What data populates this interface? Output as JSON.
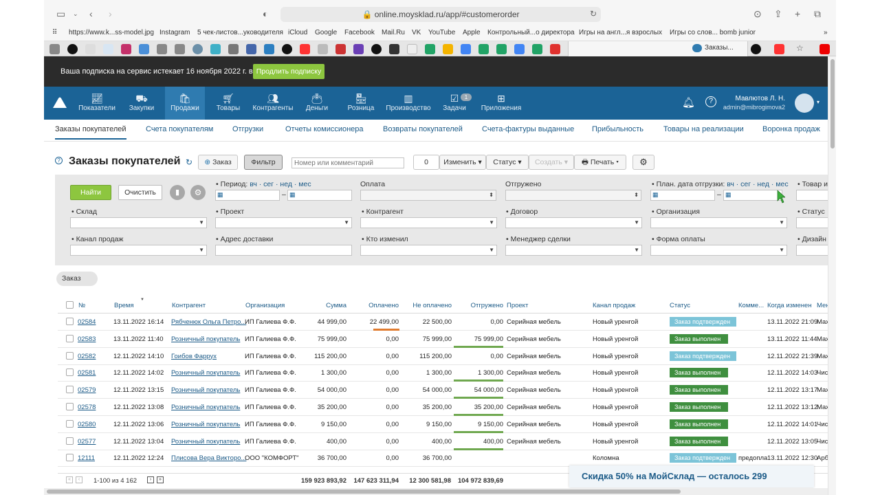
{
  "browser": {
    "url": "online.moysklad.ru/app/#customerorder",
    "bookmarks": [
      "https://www.k...ss-model.jpg",
      "Instagram",
      "5 чек-листов...уководителя",
      "iCloud",
      "Google",
      "Facebook",
      "Mail.Ru",
      "VK",
      "YouTube",
      "Apple",
      "Контрольный...о директора",
      "Игры на англ...я взрослых",
      "Игры со слов... bomb junior"
    ],
    "active_tab": "Заказы..."
  },
  "subscription": {
    "message": "Ваша подписка на сервис истекает 16 ноября 2022 г. в 07:31",
    "button": "Продлить подписку"
  },
  "nav": {
    "items": [
      {
        "label": "Показатели"
      },
      {
        "label": "Закупки"
      },
      {
        "label": "Продажи"
      },
      {
        "label": "Товары"
      },
      {
        "label": "Контрагенты"
      },
      {
        "label": "Деньги"
      },
      {
        "label": "Розница"
      },
      {
        "label": "Производство"
      },
      {
        "label": "Задачи",
        "badge": "1"
      },
      {
        "label": "Приложения"
      }
    ],
    "user_name": "Мавлютов Л. Н.",
    "user_email": "admin@mibrogimova2"
  },
  "subnav": [
    "Заказы покупателей",
    "Счета покупателям",
    "Отгрузки",
    "Отчеты комиссионера",
    "Возвраты покупателей",
    "Счета-фактуры выданные",
    "Прибыльность",
    "Товары на реализации",
    "Воронка продаж"
  ],
  "toolbar": {
    "title": "Заказы покупателей",
    "add_label": "Заказ",
    "filter_label": "Фильтр",
    "search_placeholder": "Номер или комментарий",
    "count": "0",
    "change_label": "Изменить",
    "status_label": "Статус",
    "create_label": "Создать",
    "print_label": "Печать"
  },
  "filter": {
    "find": "Найти",
    "clear": "Очистить",
    "period_label": "Период:",
    "period_links": "вч · сег · нед · мес",
    "payment_label": "Оплата",
    "shipped_label": "Отгружено",
    "plan_label": "План. дата отгрузки:",
    "plan_links": "вч · сег · нед · мес",
    "goods_label": "Товар и",
    "warehouse_label": "Склад",
    "project_label": "Проект",
    "counterparty_label": "Контрагент",
    "contract_label": "Договор",
    "organization_label": "Организация",
    "status_label": "Статус",
    "channel_label": "Канал продаж",
    "address_label": "Адрес доставки",
    "modified_by_label": "Кто изменил",
    "manager_label": "Менеджер сделки",
    "payment_form_label": "Форма оплаты",
    "design_label": "Дизайн"
  },
  "chip": "Заказ",
  "table": {
    "headers": {
      "num": "№",
      "time": "Время",
      "cp": "Контрагент",
      "org": "Организация",
      "sum": "Сумма",
      "paid": "Оплачено",
      "unpaid": "Не оплачено",
      "shipped": "Отгружено",
      "project": "Проект",
      "channel": "Канал продаж",
      "status": "Статус",
      "comment": "Комме...",
      "modified": "Когда изменен",
      "manager": "Мене"
    },
    "rows": [
      {
        "num": "02584",
        "time": "13.11.2022 16:14",
        "cp": "Рябченюк Ольга Петро...",
        "org": "ИП Галиева Ф.Ф.",
        "sum": "44 999,00",
        "paid": "22 499,00",
        "unpaid": "22 500,00",
        "shipped": "0,00",
        "project": "Серийная мебель",
        "channel": "Новый уренгой",
        "status": "Заказ подтвержден",
        "status_color": "#7cc4d8",
        "comment": "",
        "modified": "13.11.2022 21:09",
        "manager": "Мах"
      },
      {
        "num": "02583",
        "time": "13.11.2022 11:40",
        "cp": "Розничный покупатель",
        "org": "ИП Галиева Ф.Ф.",
        "sum": "75 999,00",
        "paid": "0,00",
        "unpaid": "75 999,00",
        "shipped": "75 999,00",
        "project": "Серийная мебель",
        "channel": "Новый уренгой",
        "status": "Заказ выполнен",
        "status_color": "#3f8f3f",
        "comment": "",
        "modified": "13.11.2022 11:44",
        "manager": "Мах"
      },
      {
        "num": "02582",
        "time": "12.11.2022 14:10",
        "cp": "Гоибов Фаррух",
        "org": "ИП Галиева Ф.Ф.",
        "sum": "115 200,00",
        "paid": "0,00",
        "unpaid": "115 200,00",
        "shipped": "0,00",
        "project": "Серийная мебель",
        "channel": "Новый уренгой",
        "status": "Заказ подтвержден",
        "status_color": "#7cc4d8",
        "comment": "",
        "modified": "12.11.2022 21:39",
        "manager": "Мах"
      },
      {
        "num": "02581",
        "time": "12.11.2022 14:02",
        "cp": "Розничный покупатель",
        "org": "ИП Галиева Ф.Ф.",
        "sum": "1 300,00",
        "paid": "0,00",
        "unpaid": "1 300,00",
        "shipped": "1 300,00",
        "project": "Серийная мебель",
        "channel": "Новый уренгой",
        "status": "Заказ выполнен",
        "status_color": "#3f8f3f",
        "comment": "",
        "modified": "12.11.2022 14:03",
        "manager": "Чис"
      },
      {
        "num": "02579",
        "time": "12.11.2022 13:15",
        "cp": "Розничный покупатель",
        "org": "ИП Галиева Ф.Ф.",
        "sum": "54 000,00",
        "paid": "0,00",
        "unpaid": "54 000,00",
        "shipped": "54 000,00",
        "project": "Серийная мебель",
        "channel": "Новый уренгой",
        "status": "Заказ выполнен",
        "status_color": "#3f8f3f",
        "comment": "",
        "modified": "12.11.2022 13:17",
        "manager": "Мах"
      },
      {
        "num": "02578",
        "time": "12.11.2022 13:08",
        "cp": "Розничный покупатель",
        "org": "ИП Галиева Ф.Ф.",
        "sum": "35 200,00",
        "paid": "0,00",
        "unpaid": "35 200,00",
        "shipped": "35 200,00",
        "project": "Серийная мебель",
        "channel": "Новый уренгой",
        "status": "Заказ выполнен",
        "status_color": "#3f8f3f",
        "comment": "",
        "modified": "12.11.2022 13:12",
        "manager": "Мах"
      },
      {
        "num": "02580",
        "time": "12.11.2022 13:06",
        "cp": "Розничный покупатель",
        "org": "ИП Галиева Ф.Ф.",
        "sum": "9 150,00",
        "paid": "0,00",
        "unpaid": "9 150,00",
        "shipped": "9 150,00",
        "project": "Серийная мебель",
        "channel": "Новый уренгой",
        "status": "Заказ выполнен",
        "status_color": "#3f8f3f",
        "comment": "",
        "modified": "12.11.2022 14:01",
        "manager": "Чис"
      },
      {
        "num": "02577",
        "time": "12.11.2022 13:04",
        "cp": "Розничный покупатель",
        "org": "ИП Галиева Ф.Ф.",
        "sum": "400,00",
        "paid": "0,00",
        "unpaid": "400,00",
        "shipped": "400,00",
        "project": "Серийная мебель",
        "channel": "Новый уренгой",
        "status": "Заказ выполнен",
        "status_color": "#3f8f3f",
        "comment": "",
        "modified": "12.11.2022 13:05",
        "manager": "Чис"
      },
      {
        "num": "12111",
        "time": "12.11.2022 12:24",
        "cp": "Плисова Вера Викторо...",
        "org": "ООО \"КОМФОРТ\"",
        "sum": "36 700,00",
        "paid": "0,00",
        "unpaid": "36 700,00",
        "shipped": "",
        "project": "",
        "channel": "Коломна",
        "status": "Заказ подтвержден",
        "status_color": "#7cc4d8",
        "comment": "предопла",
        "modified": "13.11.2022 12:30",
        "manager": "Арб"
      }
    ]
  },
  "footer": {
    "range": "1-100 из 4 162",
    "total_sum": "159 923 893,92",
    "total_paid": "147 623 311,94",
    "total_unpaid": "12 300 581,98",
    "total_shipped": "104 972 839,69"
  },
  "promo": "Скидка 50% на МойСклад — осталось 299",
  "colors": {
    "nav": "#1b6396",
    "find": "#8dc63f",
    "done": "#3f8f3f",
    "confirmed": "#7cc4d8",
    "paid_bar": "#e07b2e",
    "shipped_bar": "#6fa84f"
  }
}
